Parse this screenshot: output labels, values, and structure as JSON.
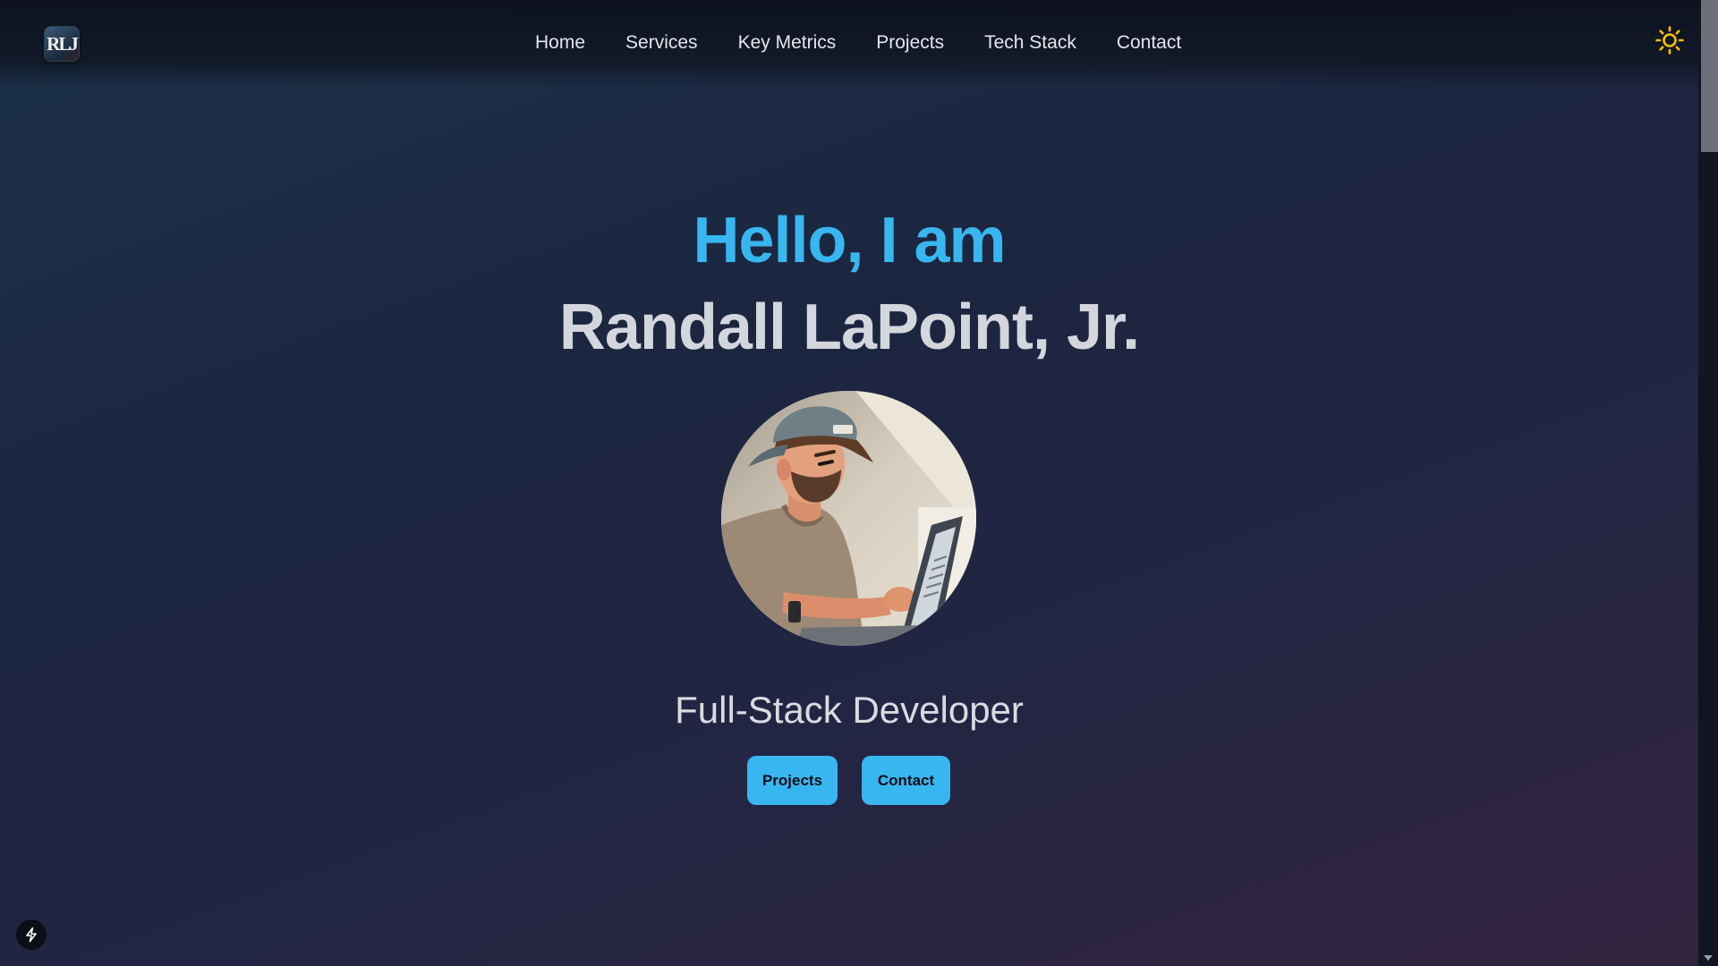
{
  "header": {
    "logo_text": "RLJ",
    "nav": [
      "Home",
      "Services",
      "Key Metrics",
      "Projects",
      "Tech Stack",
      "Contact"
    ]
  },
  "hero": {
    "greeting": "Hello, I am",
    "name": "Randall LaPoint, Jr.",
    "role": "Full-Stack Developer",
    "buttons": {
      "projects": "Projects",
      "contact": "Contact"
    }
  },
  "icons": {
    "theme_toggle": "sun-icon",
    "dev_tools": "lightning-bolt-icon"
  },
  "colors": {
    "accent": "#38b6f0",
    "sun": "#f2c200"
  }
}
